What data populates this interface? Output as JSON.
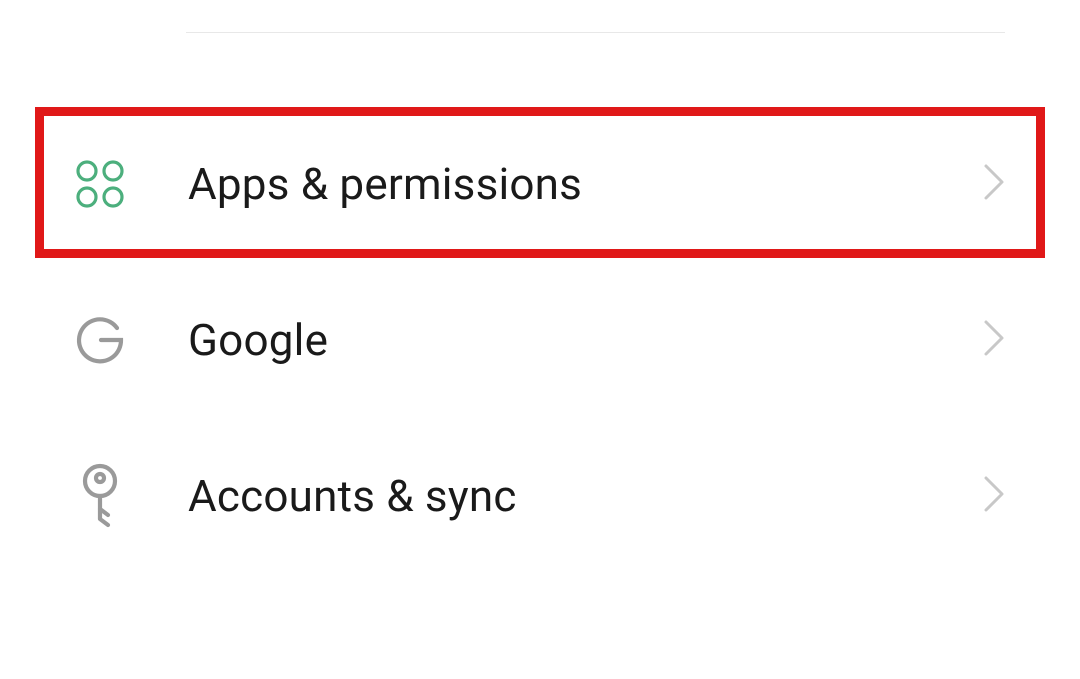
{
  "settings": {
    "items": [
      {
        "label": "Apps & permissions",
        "icon": "apps-icon",
        "highlighted": true
      },
      {
        "label": "Google",
        "icon": "google-icon",
        "highlighted": false
      },
      {
        "label": "Accounts & sync",
        "icon": "key-icon",
        "highlighted": false
      }
    ]
  },
  "colors": {
    "apps_icon": "#4caf7d",
    "neutral_icon": "#9a9a9a",
    "chevron": "#c8c8c8",
    "highlight_border": "#e01818"
  }
}
